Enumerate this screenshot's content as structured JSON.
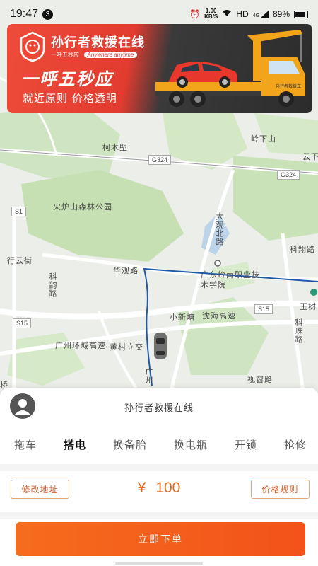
{
  "status_bar": {
    "time": "19:47",
    "notification_count": "3",
    "net_speed_value": "1.00",
    "net_speed_unit": "KB/S",
    "network": "HD",
    "signal": "4G",
    "battery": "89%"
  },
  "banner": {
    "brand": "孙行者救援在线",
    "sub_left": "一呼五秒应",
    "sub_tag": "Anywhere anytime",
    "slogan": "一呼五秒应",
    "tagline": "就近原则  价格透明",
    "truck_text": "孙行者救援车"
  },
  "map": {
    "labels": {
      "kemu": "柯木塱",
      "lingxiashan": "岭下山",
      "yun": "云下",
      "huolu": "火炉山森林公园",
      "dagaun": "大观北路",
      "xingyun": "行云街",
      "kehan": "科韵路",
      "kexiang": "科翔路",
      "huaguan": "华观路",
      "guangdong": "广东岭南职业技术学院",
      "yushu": "玉树",
      "xiaoxintang": "小新塘",
      "shenhai": "沈海高速",
      "kezhu": "科珠路",
      "guangzhou_ring": "广州环城高速",
      "huangcun": "黄村立交",
      "shixia": "视窗路",
      "qiao": "桥",
      "guang": "广州"
    },
    "shields": {
      "g324a": "G324",
      "g324b": "G324",
      "s15a": "S15",
      "s15b": "S15",
      "s1": "S1"
    }
  },
  "sheet": {
    "title": "孙行者救援在线",
    "tabs": [
      "拖车",
      "搭电",
      "换备胎",
      "换电瓶",
      "开锁",
      "抢修"
    ],
    "active_tab": "搭电",
    "edit_address": "修改地址",
    "currency": "¥",
    "price": "100",
    "price_rules": "价格规则",
    "order_button": "立即下单"
  },
  "colors": {
    "accent": "#f2521a",
    "banner_red": "#e23b2f",
    "route": "#1f5aa8"
  }
}
